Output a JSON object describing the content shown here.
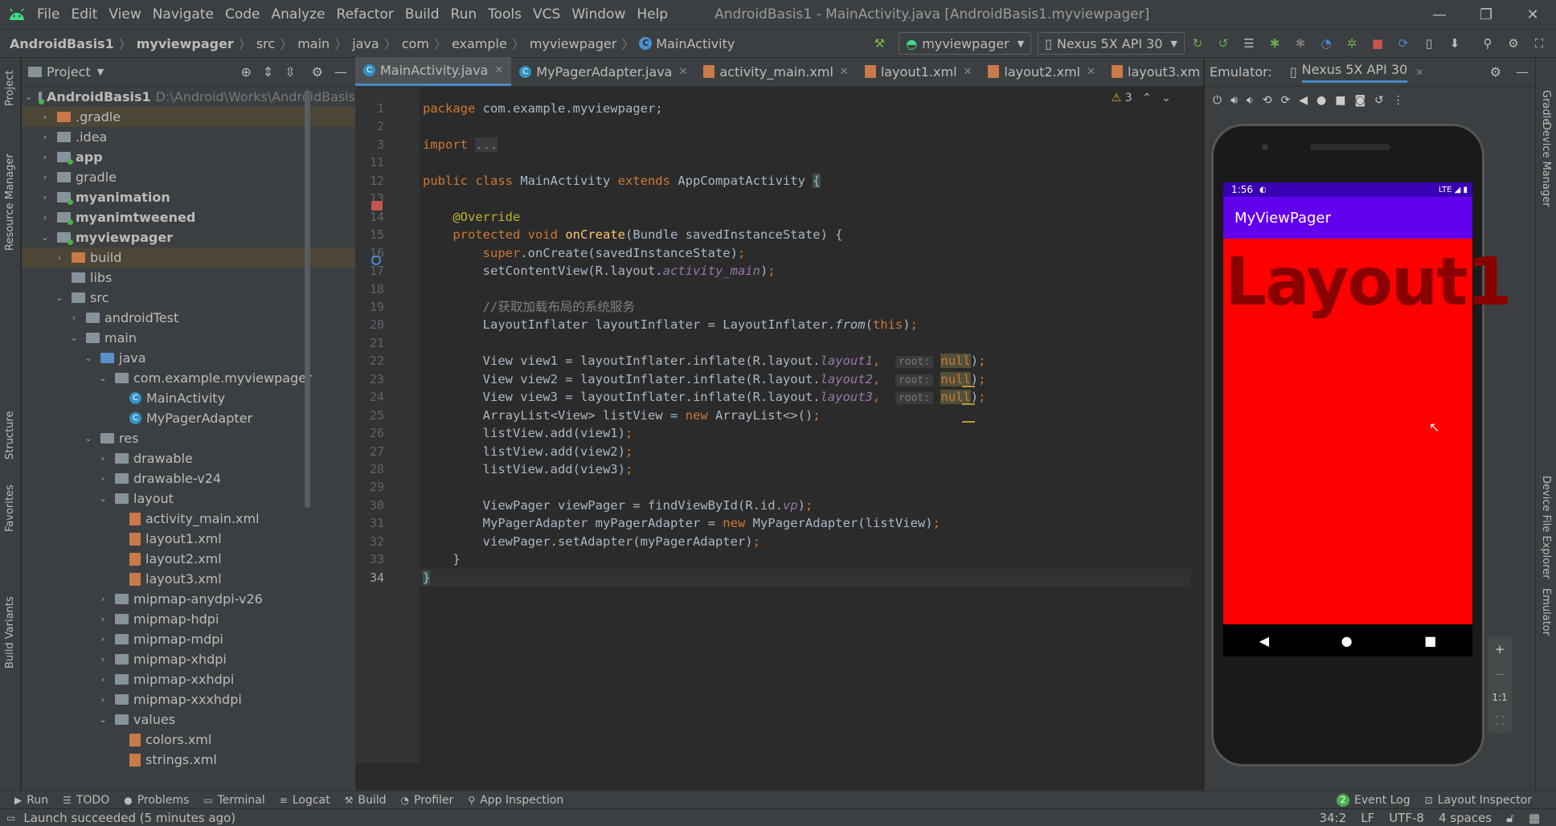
{
  "menu": {
    "items": [
      "File",
      "Edit",
      "View",
      "Navigate",
      "Code",
      "Analyze",
      "Refactor",
      "Build",
      "Run",
      "Tools",
      "VCS",
      "Window",
      "Help"
    ],
    "window_title": "AndroidBasis1 - MainActivity.java [AndroidBasis1.myviewpager]"
  },
  "nav": {
    "crumbs": [
      "AndroidBasis1",
      "myviewpager",
      "src",
      "main",
      "java",
      "com",
      "example",
      "myviewpager",
      "MainActivity"
    ],
    "run_config": "myviewpager",
    "device": "Nexus 5X API 30"
  },
  "project": {
    "header": "Project",
    "root_label": "AndroidBasis1",
    "root_path": "D:\\Android\\Works\\AndroidBasis",
    "items": [
      {
        "label": ".gradle",
        "indent": 1,
        "arrow": "›",
        "icon": "folder-orange",
        "hl": true
      },
      {
        "label": ".idea",
        "indent": 1,
        "arrow": "›",
        "icon": "folder"
      },
      {
        "label": "app",
        "indent": 1,
        "arrow": "›",
        "icon": "folder-mod",
        "bold": true
      },
      {
        "label": "gradle",
        "indent": 1,
        "arrow": "›",
        "icon": "folder"
      },
      {
        "label": "myanimation",
        "indent": 1,
        "arrow": "›",
        "icon": "folder-mod",
        "bold": true
      },
      {
        "label": "myanimtweened",
        "indent": 1,
        "arrow": "›",
        "icon": "folder-mod",
        "bold": true
      },
      {
        "label": "myviewpager",
        "indent": 1,
        "arrow": "⌄",
        "icon": "folder-mod",
        "bold": true
      },
      {
        "label": "build",
        "indent": 2,
        "arrow": "›",
        "icon": "folder-orange",
        "hl": true
      },
      {
        "label": "libs",
        "indent": 2,
        "arrow": "",
        "icon": "folder"
      },
      {
        "label": "src",
        "indent": 2,
        "arrow": "⌄",
        "icon": "folder"
      },
      {
        "label": "androidTest",
        "indent": 3,
        "arrow": "›",
        "icon": "folder"
      },
      {
        "label": "main",
        "indent": 3,
        "arrow": "⌄",
        "icon": "folder"
      },
      {
        "label": "java",
        "indent": 4,
        "arrow": "⌄",
        "icon": "folder-blue"
      },
      {
        "label": "com.example.myviewpager",
        "indent": 5,
        "arrow": "⌄",
        "icon": "folder"
      },
      {
        "label": "MainActivity",
        "indent": 6,
        "arrow": "",
        "icon": "java"
      },
      {
        "label": "MyPagerAdapter",
        "indent": 6,
        "arrow": "",
        "icon": "java"
      },
      {
        "label": "res",
        "indent": 4,
        "arrow": "⌄",
        "icon": "folder"
      },
      {
        "label": "drawable",
        "indent": 5,
        "arrow": "›",
        "icon": "folder"
      },
      {
        "label": "drawable-v24",
        "indent": 5,
        "arrow": "›",
        "icon": "folder"
      },
      {
        "label": "layout",
        "indent": 5,
        "arrow": "⌄",
        "icon": "folder"
      },
      {
        "label": "activity_main.xml",
        "indent": 6,
        "arrow": "",
        "icon": "xml"
      },
      {
        "label": "layout1.xml",
        "indent": 6,
        "arrow": "",
        "icon": "xml"
      },
      {
        "label": "layout2.xml",
        "indent": 6,
        "arrow": "",
        "icon": "xml"
      },
      {
        "label": "layout3.xml",
        "indent": 6,
        "arrow": "",
        "icon": "xml"
      },
      {
        "label": "mipmap-anydpi-v26",
        "indent": 5,
        "arrow": "›",
        "icon": "folder"
      },
      {
        "label": "mipmap-hdpi",
        "indent": 5,
        "arrow": "›",
        "icon": "folder"
      },
      {
        "label": "mipmap-mdpi",
        "indent": 5,
        "arrow": "›",
        "icon": "folder"
      },
      {
        "label": "mipmap-xhdpi",
        "indent": 5,
        "arrow": "›",
        "icon": "folder"
      },
      {
        "label": "mipmap-xxhdpi",
        "indent": 5,
        "arrow": "›",
        "icon": "folder"
      },
      {
        "label": "mipmap-xxxhdpi",
        "indent": 5,
        "arrow": "›",
        "icon": "folder"
      },
      {
        "label": "values",
        "indent": 5,
        "arrow": "⌄",
        "icon": "folder"
      },
      {
        "label": "colors.xml",
        "indent": 6,
        "arrow": "",
        "icon": "xml"
      },
      {
        "label": "strings.xml",
        "indent": 6,
        "arrow": "",
        "icon": "xml"
      }
    ]
  },
  "left_strip": [
    "Project",
    "Resource Manager",
    "Structure",
    "Favorites",
    "Build Variants"
  ],
  "right_strip": [
    "Gradle",
    "Device Manager",
    "Device File Explorer",
    "Emulator"
  ],
  "tabs": [
    {
      "label": "MainActivity.java",
      "active": true,
      "icon": "java"
    },
    {
      "label": "MyPagerAdapter.java",
      "icon": "java"
    },
    {
      "label": "activity_main.xml",
      "icon": "xml"
    },
    {
      "label": "layout1.xml",
      "icon": "xml"
    },
    {
      "label": "layout2.xml",
      "icon": "xml"
    },
    {
      "label": "layout3.xm",
      "icon": "xml"
    }
  ],
  "warnings": "3",
  "code": [
    {
      "n": "1",
      "html": "<span class='kw'>package</span> com.example.myviewpager;"
    },
    {
      "n": "2",
      "html": ""
    },
    {
      "n": "3",
      "html": "<span class='kw'>import</span> <span class='cm' style='background:#3b3b3b'>...</span>"
    },
    {
      "n": "11",
      "html": ""
    },
    {
      "n": "12",
      "html": "<span class='kw'>public class</span> MainActivity <span class='kw'>extends</span> AppCompatActivity <span style='background:#3b514d'>{</span>"
    },
    {
      "n": "13",
      "html": ""
    },
    {
      "n": "14",
      "html": "    <span class='an'>@Override</span>"
    },
    {
      "n": "15",
      "html": "    <span class='kw'>protected void</span> <span class='fn'>onCreate</span>(Bundle savedInstanceState) {"
    },
    {
      "n": "16",
      "html": "        <span class='kw'>super</span>.onCreate(savedInstanceState)<span class='kw'>;</span>"
    },
    {
      "n": "17",
      "html": "        setContentView(R.layout.<span class='it'>activity_main</span>)<span class='kw'>;</span>"
    },
    {
      "n": "18",
      "html": ""
    },
    {
      "n": "19",
      "html": "        <span class='cm'>//获取加载布局的系统服务</span>"
    },
    {
      "n": "20",
      "html": "        LayoutInflater layoutInflater = LayoutInflater.<span style='font-style:italic'>from</span>(<span class='kw'>this</span>)<span class='kw'>;</span>"
    },
    {
      "n": "21",
      "html": ""
    },
    {
      "n": "22",
      "html": "        View view1 = layoutInflater.inflate(R.layout.<span class='it'>layout1</span><span class='kw'>,</span>  <span class='hint'>root:</span> <span class='nul'>null</span>)<span class='kw'>;</span>"
    },
    {
      "n": "23",
      "html": "        View view2 = layoutInflater.inflate(R.layout.<span class='it'>layout2</span><span class='kw'>,</span>  <span class='hint'>root:</span> <span class='nul'>null</span>)<span class='kw'>;</span>"
    },
    {
      "n": "24",
      "html": "        View view3 = layoutInflater.inflate(R.layout.<span class='it'>layout3</span><span class='kw'>,</span>  <span class='hint'>root:</span> <span class='nul'>null</span>)<span class='kw'>;</span>"
    },
    {
      "n": "25",
      "html": "        ArrayList&lt;View&gt; listView = <span class='kw'>new</span> ArrayList&lt;&gt;()<span class='kw'>;</span>"
    },
    {
      "n": "26",
      "html": "        listView.add(view1)<span class='kw'>;</span>"
    },
    {
      "n": "27",
      "html": "        listView.add(view2)<span class='kw'>;</span>"
    },
    {
      "n": "28",
      "html": "        listView.add(view3)<span class='kw'>;</span>"
    },
    {
      "n": "29",
      "html": ""
    },
    {
      "n": "30",
      "html": "        ViewPager viewPager = findViewById(R.id.<span class='it'>vp</span>)<span class='kw'>;</span>"
    },
    {
      "n": "31",
      "html": "        MyPagerAdapter myPagerAdapter = <span class='kw'>new</span> MyPagerAdapter(listView)<span class='kw'>;</span>"
    },
    {
      "n": "32",
      "html": "        viewPager.setAdapter(myPagerAdapter)<span class='kw'>;</span>"
    },
    {
      "n": "33",
      "html": "    }"
    },
    {
      "n": "34",
      "html": "<span style='background:#3b514d'>}</span>"
    }
  ],
  "emulator": {
    "label": "Emulator:",
    "device_tab": "Nexus 5X API 30",
    "status_time": "1:56",
    "status_right": "LTE ◢ ▮",
    "app_title": "MyViewPager",
    "page_text": "Layout1",
    "nav_back": "◀",
    "nav_home": "●",
    "nav_recent": "■",
    "zoom_in": "+",
    "zoom_out": "−",
    "zoom_ratio": "1:1",
    "screen_color": "#ff0000",
    "appbar_color": "#6200ee"
  },
  "bottom": {
    "items": [
      {
        "label": "Run",
        "icon": "▶"
      },
      {
        "label": "TODO",
        "icon": "☰"
      },
      {
        "label": "Problems",
        "icon": "●"
      },
      {
        "label": "Terminal",
        "icon": "▭"
      },
      {
        "label": "Logcat",
        "icon": "≡"
      },
      {
        "label": "Build",
        "icon": "⚒"
      },
      {
        "label": "Profiler",
        "icon": "◔"
      },
      {
        "label": "App Inspection",
        "icon": "⚲"
      }
    ],
    "event_log_count": "2",
    "event_log": "Event Log",
    "layout_inspector": "Layout Inspector"
  },
  "status": {
    "message": "Launch succeeded (5 minutes ago)",
    "position": "34:2",
    "line_sep": "LF",
    "encoding": "UTF-8",
    "indent": "4 spaces"
  }
}
